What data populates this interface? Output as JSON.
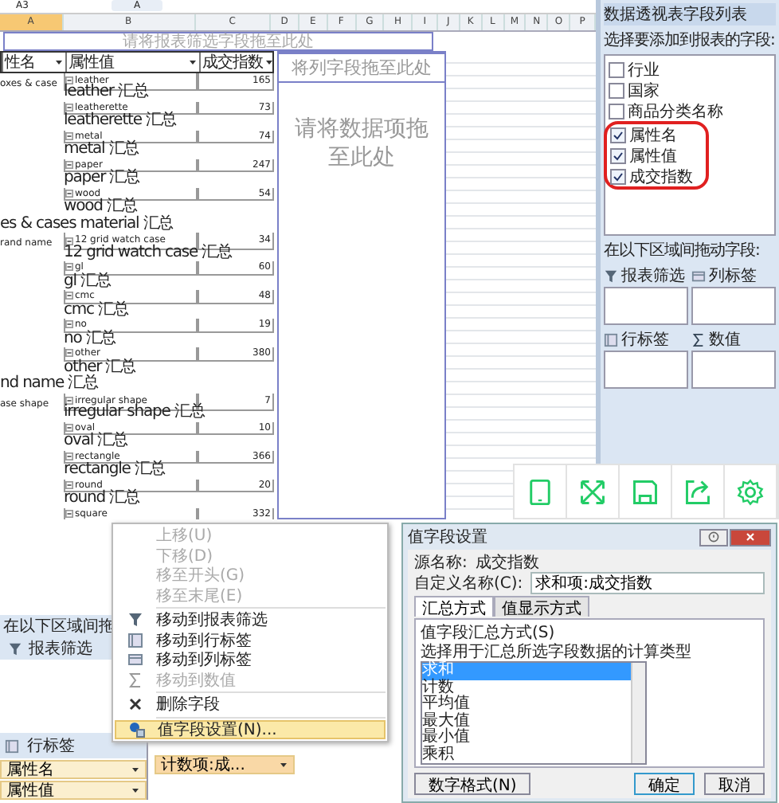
{
  "spreadsheet": {
    "name_box": "A3",
    "formula": "A",
    "columns": [
      "A",
      "B",
      "C",
      "D",
      "E",
      "F",
      "G",
      "H",
      "I",
      "J",
      "K",
      "L",
      "M",
      "N",
      "O",
      "P"
    ],
    "filter_drop_hint": "请将报表筛选字段拖至此处",
    "column_drop_hint": "将列字段拖至此处",
    "data_drop_hint": "请将数据项拖至此处",
    "pivot_headers": [
      "性名",
      "属性值",
      "成交指数"
    ],
    "pivot_rows": [
      {
        "kind": "item",
        "column_1": "oxes & case",
        "column_2": "leather",
        "column_3": "165"
      },
      {
        "kind": "subtotal",
        "column_2": "leather 汇总"
      },
      {
        "kind": "item",
        "column_2": "leatherette",
        "column_3": "73"
      },
      {
        "kind": "subtotal",
        "column_2": "leatherette 汇总"
      },
      {
        "kind": "item",
        "column_2": "metal",
        "column_3": "74"
      },
      {
        "kind": "subtotal",
        "column_2": "metal 汇总"
      },
      {
        "kind": "item",
        "column_2": "paper",
        "column_3": "247"
      },
      {
        "kind": "subtotal",
        "column_2": "paper 汇总"
      },
      {
        "kind": "item",
        "column_2": "wood",
        "column_3": "54"
      },
      {
        "kind": "subtotal",
        "column_2": "wood 汇总"
      },
      {
        "kind": "group_total",
        "column_1": "es & cases material 汇总"
      },
      {
        "kind": "item",
        "column_1": "rand name",
        "column_2": "12 grid watch case",
        "column_3": "34"
      },
      {
        "kind": "subtotal",
        "column_2": "12 grid watch case 汇总"
      },
      {
        "kind": "item",
        "column_2": "gl",
        "column_3": "60"
      },
      {
        "kind": "subtotal",
        "column_2": "gl 汇总"
      },
      {
        "kind": "item",
        "column_2": "cmc",
        "column_3": "48"
      },
      {
        "kind": "subtotal",
        "column_2": "cmc 汇总"
      },
      {
        "kind": "item",
        "column_2": "no",
        "column_3": "19"
      },
      {
        "kind": "subtotal",
        "column_2": "no 汇总"
      },
      {
        "kind": "item",
        "column_2": "other",
        "column_3": "380"
      },
      {
        "kind": "subtotal",
        "column_2": "other 汇总"
      },
      {
        "kind": "group_total",
        "column_1": "nd name 汇总"
      },
      {
        "kind": "item",
        "column_1": "ase shape",
        "column_2": "irregular shape",
        "column_3": "7"
      },
      {
        "kind": "subtotal",
        "column_2": "irregular shape 汇总"
      },
      {
        "kind": "item",
        "column_2": "oval",
        "column_3": "10"
      },
      {
        "kind": "subtotal",
        "column_2": "oval 汇总"
      },
      {
        "kind": "item",
        "column_2": "rectangle",
        "column_3": "366"
      },
      {
        "kind": "subtotal",
        "column_2": "rectangle 汇总"
      },
      {
        "kind": "item",
        "column_2": "round",
        "column_3": "20"
      },
      {
        "kind": "subtotal",
        "column_2": "round 汇总"
      },
      {
        "kind": "item",
        "column_2": "square",
        "column_3": "332"
      }
    ]
  },
  "field_list": {
    "title": "数据透视表字段列表",
    "prompt": "选择要添加到报表的字段:",
    "fields": [
      {
        "label": "行业",
        "checked": false
      },
      {
        "label": "国家",
        "checked": false
      },
      {
        "label": "商品分类名称",
        "checked": false
      },
      {
        "label": "属性名",
        "checked": true
      },
      {
        "label": "属性值",
        "checked": true
      },
      {
        "label": "成交指数",
        "checked": true
      }
    ],
    "areas_prompt": "在以下区域间拖动字段:",
    "areas": [
      {
        "label": "报表筛选",
        "kind": "filter"
      },
      {
        "label": "列标签",
        "kind": "columns"
      },
      {
        "label": "行标签",
        "kind": "rows"
      },
      {
        "label": "数值",
        "kind": "values"
      }
    ]
  },
  "bottom_pane": {
    "areas_prompt": "在以下区域间拖",
    "filter_label": "报表筛选",
    "rows_label": "行标签",
    "row_fields": [
      "属性名",
      "属性值"
    ],
    "value_field": "计数项:成..."
  },
  "context_menu": [
    {
      "label": "上移(U)",
      "kind": "plain",
      "disabled": true,
      "selected": false,
      "divider_above": false
    },
    {
      "label": "下移(D)",
      "kind": "plain",
      "disabled": true,
      "selected": false,
      "divider_above": false
    },
    {
      "label": "移至开头(G)",
      "kind": "plain",
      "disabled": true,
      "selected": false,
      "divider_above": false
    },
    {
      "label": "移至末尾(E)",
      "kind": "plain",
      "disabled": true,
      "selected": false,
      "divider_above": false
    },
    {
      "label": "移动到报表筛选",
      "kind": "filter",
      "disabled": false,
      "selected": false,
      "divider_above": true
    },
    {
      "label": "移动到行标签",
      "kind": "rows",
      "disabled": false,
      "selected": false,
      "divider_above": false
    },
    {
      "label": "移动到列标签",
      "kind": "columns",
      "disabled": false,
      "selected": false,
      "divider_above": false
    },
    {
      "label": "移动到数值",
      "kind": "values",
      "disabled": true,
      "selected": false,
      "divider_above": false
    },
    {
      "label": "删除字段",
      "kind": "delete",
      "disabled": false,
      "selected": false,
      "divider_above": true
    },
    {
      "label": "值字段设置(N)...",
      "kind": "settings",
      "disabled": false,
      "selected": true,
      "divider_above": true
    }
  ],
  "dialog": {
    "title": "值字段设置",
    "source_label": "源名称:",
    "source_name": "成交指数",
    "custom_name_label": "自定义名称(C):",
    "custom_name": "求和项:成交指数",
    "tabs": [
      {
        "label": "汇总方式",
        "selected": true
      },
      {
        "label": "值显示方式",
        "selected": false
      }
    ],
    "section_label": "值字段汇总方式(S)",
    "description": "选择用于汇总所选字段数据的计算类型",
    "functions": [
      {
        "label": "求和",
        "selected": true
      },
      {
        "label": "计数",
        "selected": false
      },
      {
        "label": "平均值",
        "selected": false
      },
      {
        "label": "最大值",
        "selected": false
      },
      {
        "label": "最小值",
        "selected": false
      },
      {
        "label": "乘积",
        "selected": false
      }
    ],
    "buttons": [
      {
        "label": "数字格式(N)",
        "kind": "plain"
      },
      {
        "label": "确定",
        "kind": "default"
      },
      {
        "label": "取消",
        "kind": "plain"
      }
    ]
  }
}
